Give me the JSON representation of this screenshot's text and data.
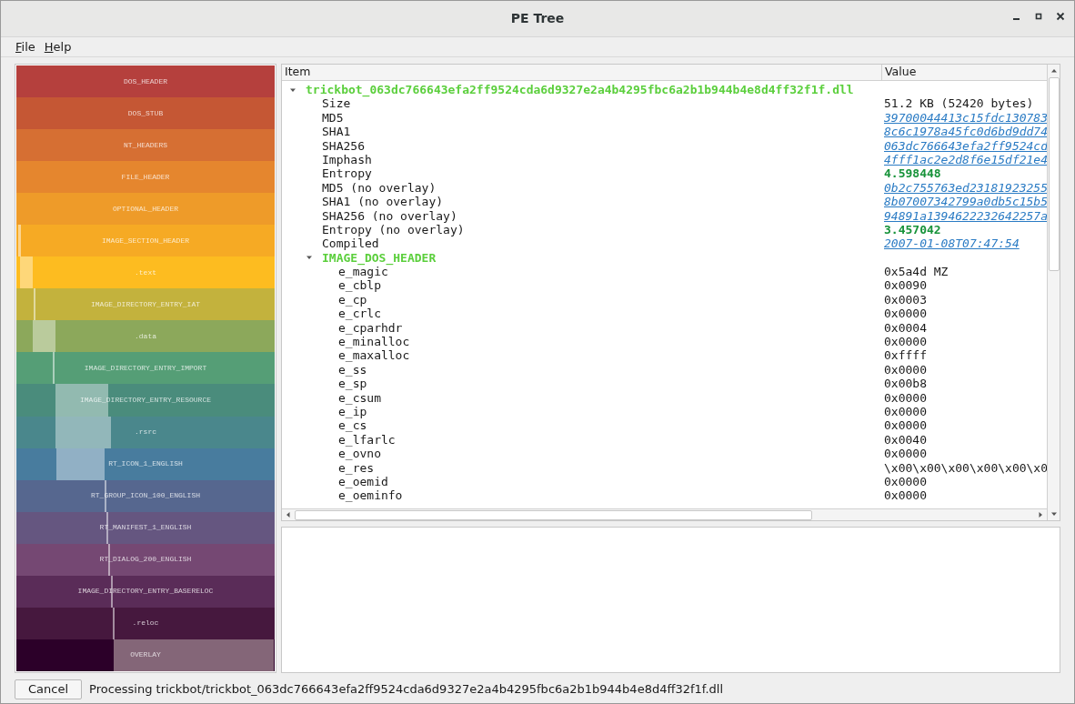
{
  "window": {
    "title": "PE Tree"
  },
  "menu": [
    {
      "label": "File"
    },
    {
      "label": "Help"
    }
  ],
  "regions": [
    {
      "label": "DOS_HEADER",
      "color": "#b5403d"
    },
    {
      "label": "DOS_STUB",
      "color": "#c55734"
    },
    {
      "label": "NT_HEADERS",
      "color": "#d66f33"
    },
    {
      "label": "FILE_HEADER",
      "color": "#e5862e"
    },
    {
      "label": "OPTIONAL_HEADER",
      "color": "#ee9b29"
    },
    {
      "label": "IMAGE_SECTION_HEADER",
      "color": "#f6aa24"
    },
    {
      "label": ".text",
      "color": "#fdbc20"
    },
    {
      "label": "IMAGE_DIRECTORY_ENTRY_IAT",
      "color": "#c3b23d"
    },
    {
      "label": ".data",
      "color": "#8ca85b"
    },
    {
      "label": "IMAGE_DIRECTORY_ENTRY_IMPORT",
      "color": "#559e76"
    },
    {
      "label": "IMAGE_DIRECTORY_ENTRY_RESOURCE",
      "color": "#4a8c7c"
    },
    {
      "label": ".rsrc",
      "color": "#4a878c"
    },
    {
      "label": "RT_ICON_1_ENGLISH",
      "color": "#487c9e"
    },
    {
      "label": "RT_GROUP_ICON_100_ENGLISH",
      "color": "#56678f"
    },
    {
      "label": "RT_MANIFEST_1_ENGLISH",
      "color": "#655680"
    },
    {
      "label": "RT_DIALOG_200_ENGLISH",
      "color": "#754873"
    },
    {
      "label": "IMAGE_DIRECTORY_ENTRY_BASERELOC",
      "color": "#5a2c58"
    },
    {
      "label": ".reloc",
      "color": "#46183e"
    },
    {
      "label": "OVERLAY",
      "color": "#2c0029"
    }
  ],
  "tree": {
    "columns": [
      "Item",
      "Value"
    ],
    "items": [
      {
        "name": "trickbot_063dc766643efa2ff9524cda6d9327e2a4b4295fbc6a2b1b944b4e8d4ff32f1f.dll",
        "expanded": true,
        "children": [
          {
            "name": "Size",
            "value": "51.2 KB (52420 bytes)",
            "kind": "plain"
          },
          {
            "name": "MD5",
            "value": "39700044413c15fdc130783",
            "kind": "link"
          },
          {
            "name": "SHA1",
            "value": "8c6c1978a45fc0d6bd9dd74",
            "kind": "link"
          },
          {
            "name": "SHA256",
            "value": "063dc766643efa2ff9524cd",
            "kind": "link"
          },
          {
            "name": "Imphash",
            "value": "4fff1ac2e2d8f6e15df21e4",
            "kind": "link"
          },
          {
            "name": "Entropy",
            "value": "4.598448",
            "kind": "good"
          },
          {
            "name": "MD5 (no overlay)",
            "value": "0b2c755763ed23181923255",
            "kind": "link"
          },
          {
            "name": "SHA1 (no overlay)",
            "value": "8b07007342799a0db5c15b5",
            "kind": "link"
          },
          {
            "name": "SHA256 (no overlay)",
            "value": "94891a1394622232642257a",
            "kind": "link"
          },
          {
            "name": "Entropy (no overlay)",
            "value": "3.457042",
            "kind": "good"
          },
          {
            "name": "Compiled",
            "value": "2007-01-08T07:47:54",
            "kind": "link"
          },
          {
            "name": "IMAGE_DOS_HEADER",
            "expanded": true,
            "children": [
              {
                "name": "e_magic",
                "value": "0x5a4d MZ",
                "kind": "plain"
              },
              {
                "name": "e_cblp",
                "value": "0x0090",
                "kind": "plain"
              },
              {
                "name": "e_cp",
                "value": "0x0003",
                "kind": "plain"
              },
              {
                "name": "e_crlc",
                "value": "0x0000",
                "kind": "plain"
              },
              {
                "name": "e_cparhdr",
                "value": "0x0004",
                "kind": "plain"
              },
              {
                "name": "e_minalloc",
                "value": "0x0000",
                "kind": "plain"
              },
              {
                "name": "e_maxalloc",
                "value": "0xffff",
                "kind": "plain"
              },
              {
                "name": "e_ss",
                "value": "0x0000",
                "kind": "plain"
              },
              {
                "name": "e_sp",
                "value": "0x00b8",
                "kind": "plain"
              },
              {
                "name": "e_csum",
                "value": "0x0000",
                "kind": "plain"
              },
              {
                "name": "e_ip",
                "value": "0x0000",
                "kind": "plain"
              },
              {
                "name": "e_cs",
                "value": "0x0000",
                "kind": "plain"
              },
              {
                "name": "e_lfarlc",
                "value": "0x0040",
                "kind": "plain"
              },
              {
                "name": "e_ovno",
                "value": "0x0000",
                "kind": "plain"
              },
              {
                "name": "e_res",
                "value": "\\x00\\x00\\x00\\x00\\x00\\x0",
                "kind": "plain"
              },
              {
                "name": "e_oemid",
                "value": "0x0000",
                "kind": "plain"
              },
              {
                "name": "e_oeminfo",
                "value": "0x0000",
                "kind": "plain"
              }
            ]
          }
        ]
      }
    ]
  },
  "status_bar": {
    "button": "Cancel",
    "message": "Processing trickbot/trickbot_063dc766643efa2ff9524cda6d9327e2a4b4295fbc6a2b1b944b4e8d4ff32f1f.dll"
  }
}
